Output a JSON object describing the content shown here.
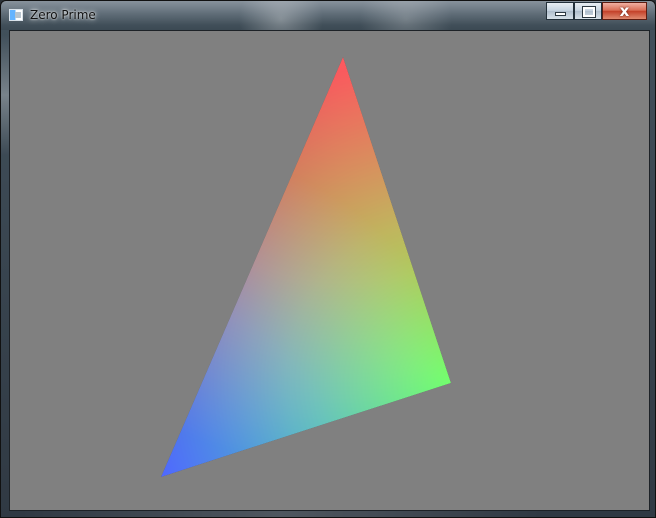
{
  "window": {
    "title": "Zero Prime",
    "close_label": "x"
  },
  "viewport": {
    "background_color": "#808080"
  },
  "triangle": {
    "top_color": "#ff0000",
    "right_color": "#00ff00",
    "bottom_left_color": "#0000ff"
  },
  "icons": {
    "app": "app-window-icon",
    "minimize": "minimize-icon",
    "maximize": "maximize-icon",
    "close": "close-icon"
  }
}
